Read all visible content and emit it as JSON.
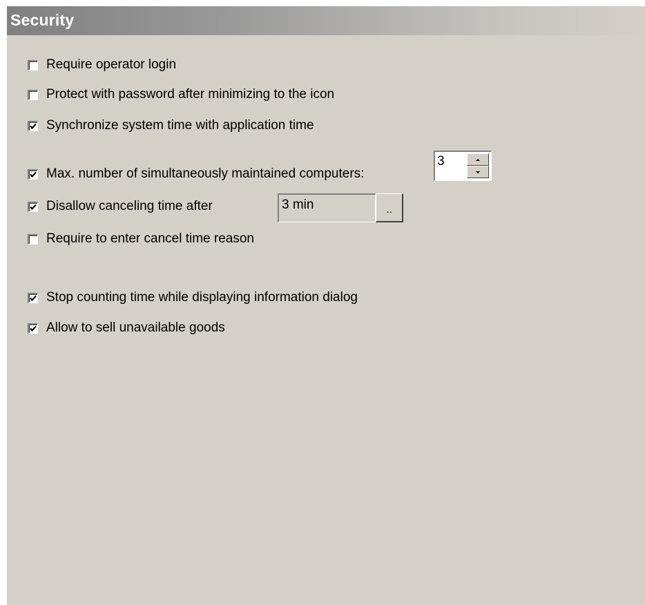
{
  "header": {
    "title": "Security"
  },
  "options": [
    {
      "label": "Require operator login",
      "checked": false
    },
    {
      "label": "Protect with password after minimizing to the icon",
      "checked": false
    },
    {
      "label": "Synchronize system time with application time",
      "checked": true
    },
    {
      "label": "Max. number of simultaneously maintained computers:",
      "checked": true
    },
    {
      "label": "Disallow canceling time after",
      "checked": true
    },
    {
      "label": "Require to enter cancel time reason",
      "checked": false
    },
    {
      "label": "Stop counting time while displaying information dialog",
      "checked": true
    },
    {
      "label": "Allow to sell unavailable goods",
      "checked": true
    }
  ],
  "max_computers": {
    "value": "3"
  },
  "cancel_time": {
    "value": "3 min",
    "button_label": ".."
  },
  "colors": {
    "panel": "#d4d0c8",
    "header_start": "#808080",
    "header_end": "#d4d0c8"
  },
  "icons": {
    "checkmark": "checkmark-icon",
    "spin_up": "arrow-up-icon",
    "spin_down": "arrow-down-icon"
  }
}
